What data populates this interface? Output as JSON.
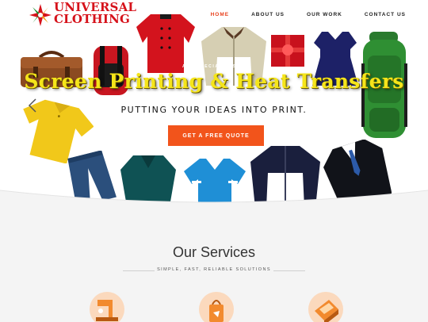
{
  "logo": {
    "line1": "UNIVERSAL",
    "line2": "CLOTHING"
  },
  "nav": {
    "items": [
      {
        "label": "HOME"
      },
      {
        "label": "ABOUT US"
      },
      {
        "label": "OUR WORK"
      },
      {
        "label": "CONTACT US"
      }
    ]
  },
  "hero": {
    "tagline": "ARE SPECIALISTS IN",
    "headline": "Screen Printing & Heat Transfers",
    "subline": "PUTTING YOUR IDEAS INTO PRINT.",
    "cta": "GET A FREE QUOTE"
  },
  "services": {
    "title": "Our Services",
    "subtitle": "SIMPLE, FAST, RELIABLE SOLUTIONS"
  },
  "colors": {
    "accent": "#f2541b",
    "headline": "#f5e51a",
    "logo_red": "#d6121b",
    "icon_bg": "#fbd9bd"
  }
}
